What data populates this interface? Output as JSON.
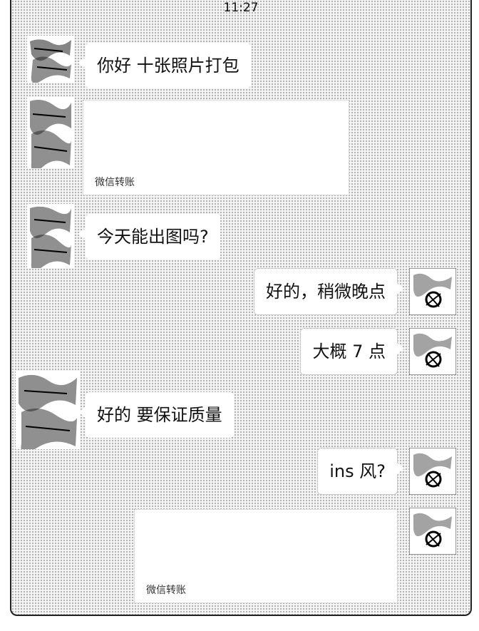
{
  "status_bar": {
    "time": "11:27"
  },
  "messages": [
    {
      "text": "你好 十张照片打包"
    },
    {
      "transfer_label": "微信转账"
    },
    {
      "text": "今天能出图吗?"
    },
    {
      "text": "好的，稍微晚点"
    },
    {
      "text": "大概 7 点"
    },
    {
      "text": "好的 要保证质量"
    },
    {
      "text": "ins 风?"
    },
    {
      "transfer_label": "微信转账"
    }
  ],
  "icons": {
    "contact_avatar": "sketch-avatar-icon",
    "self_avatar": "cat-avatar-icon"
  }
}
